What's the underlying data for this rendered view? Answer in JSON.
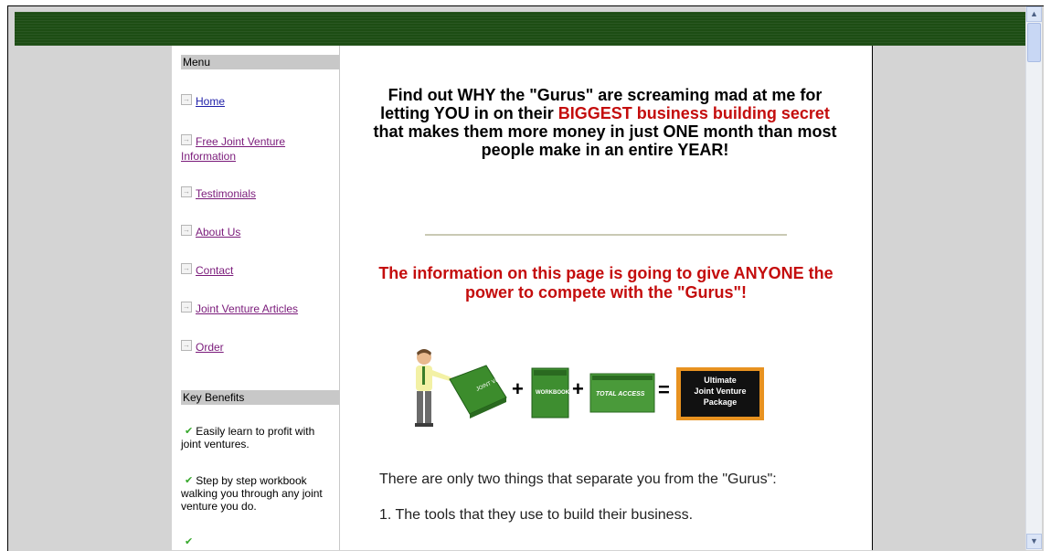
{
  "sidebar": {
    "menu_heading": "Menu",
    "menu_items": [
      {
        "label": "Home"
      },
      {
        "label": "Free Joint Venture Information"
      },
      {
        "label": "Testimonials"
      },
      {
        "label": "About Us"
      },
      {
        "label": "Contact"
      },
      {
        "label": "Joint Venture Articles"
      },
      {
        "label": "Order"
      }
    ],
    "benefits_heading": "Key Benefits",
    "benefits": [
      {
        "text": "Easily learn to profit with joint ventures."
      },
      {
        "text": "Step by step workbook walking you through any joint venture you do."
      }
    ]
  },
  "main": {
    "headline": {
      "part1": "Find out WHY the \"Gurus\" are screaming mad at me for letting YOU in on their ",
      "highlight": "BIGGEST business building secret",
      "part2": " that makes them more money in just ONE month than most people make in an entire YEAR!"
    },
    "subheadline": "The information on this page is going to give ANYONE the power to compete with the \"Gurus\"!",
    "promo": {
      "book1": "JOINT VENTURE SEEKER",
      "book2": "WORKBOOK",
      "book3": "TOTAL ACCESS",
      "plus": "+",
      "equals": "=",
      "package_label": "Ultimate Joint Venture Package"
    },
    "paragraph1": "There are only two things that separate you from the \"Gurus\":",
    "paragraph2": "1. The tools that they use to build their business."
  },
  "colors": {
    "header_bar": "#1d4d14",
    "accent_red": "#c40d0d",
    "link_blue": "#1f1fa8",
    "link_visited": "#7a1a7a"
  }
}
